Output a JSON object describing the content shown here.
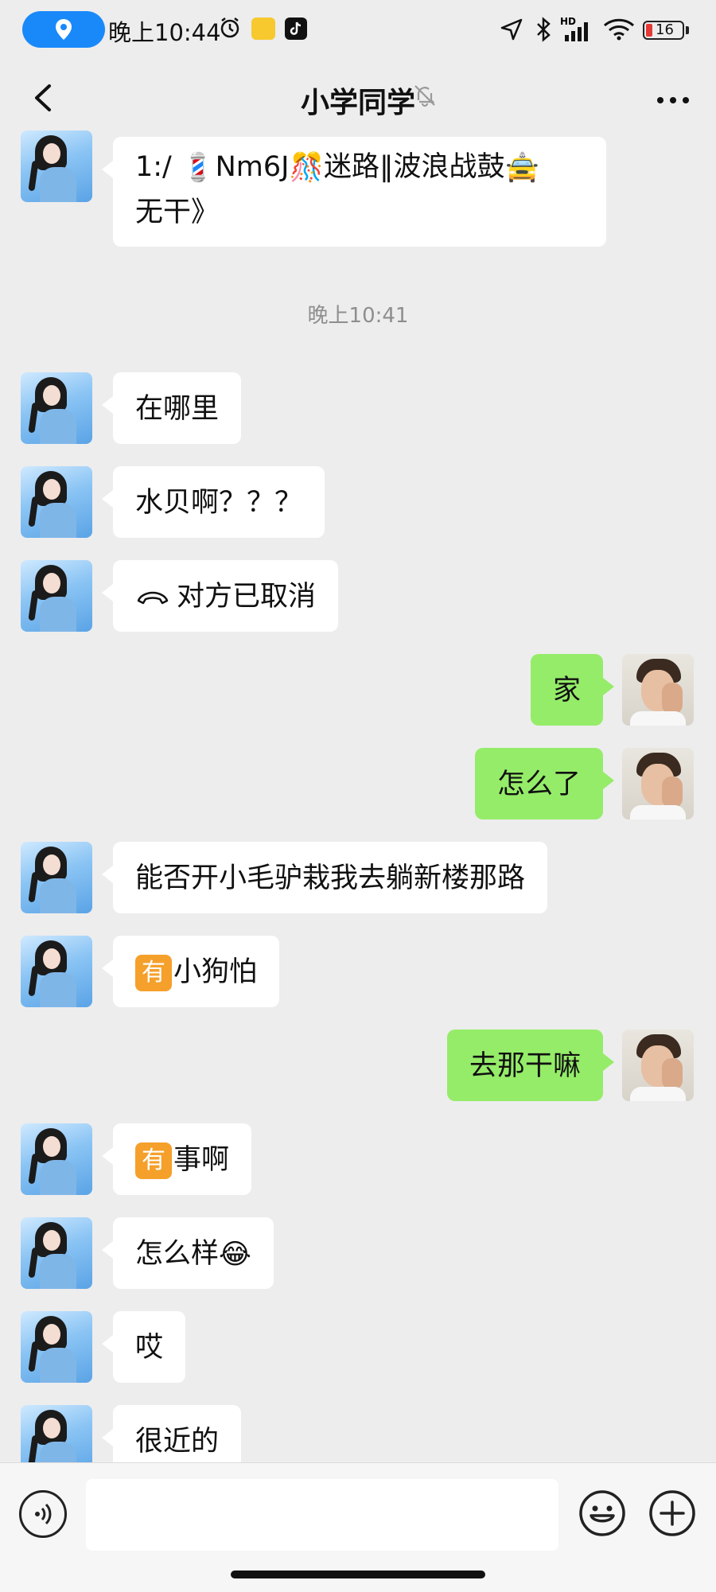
{
  "status_bar": {
    "time": "晚上10:44",
    "battery": "16",
    "network_tag": "HD",
    "icons": [
      "location-icon",
      "alarm-icon",
      "notification-app-icon",
      "tiktok-icon",
      "navigation-icon",
      "bluetooth-icon",
      "signal-icon",
      "wifi-icon",
      "battery-icon"
    ]
  },
  "header": {
    "title": "小学同学",
    "back_icon": "chevron-left-icon",
    "mute_icon": "bell-off-icon",
    "more_icon": "more-icon"
  },
  "messages": [
    {
      "side": "left",
      "text_pre": "1:/ ",
      "emoji_a": "💈",
      "text_mid": "Nm6J",
      "emoji_b": "🎊",
      "text_post": "迷路‖波浪战鼓",
      "emoji_c": "🚖",
      "text_line2": "无干》"
    },
    {
      "type": "timestamp",
      "text": "晚上10:41"
    },
    {
      "side": "left",
      "text": "在哪里"
    },
    {
      "side": "left",
      "text": "水贝啊？？？"
    },
    {
      "side": "left",
      "icon": "hangup-icon",
      "text": "对方已取消"
    },
    {
      "side": "right",
      "text": "家"
    },
    {
      "side": "right",
      "text": "怎么了"
    },
    {
      "side": "left",
      "text": "能否开小毛驴栽我去躺新楼那路"
    },
    {
      "side": "left",
      "badge": "有",
      "text": "小狗怕"
    },
    {
      "side": "right",
      "text": "去那干嘛"
    },
    {
      "side": "left",
      "badge": "有",
      "text": "事啊"
    },
    {
      "side": "left",
      "text": "怎么样",
      "emoji": "😂"
    },
    {
      "side": "left",
      "text": "哎"
    },
    {
      "side": "left",
      "text": "很近的"
    }
  ],
  "input_bar": {
    "voice_icon": "voice-icon",
    "input_value": "",
    "emoji_icon": "emoji-icon",
    "plus_icon": "plus-icon"
  },
  "colors": {
    "background": "#ededed",
    "bubble_self": "#95ec69",
    "bubble_other": "#ffffff",
    "location_pill": "#1989fa",
    "badge": "#f5a02b",
    "battery_low": "#e53935"
  }
}
